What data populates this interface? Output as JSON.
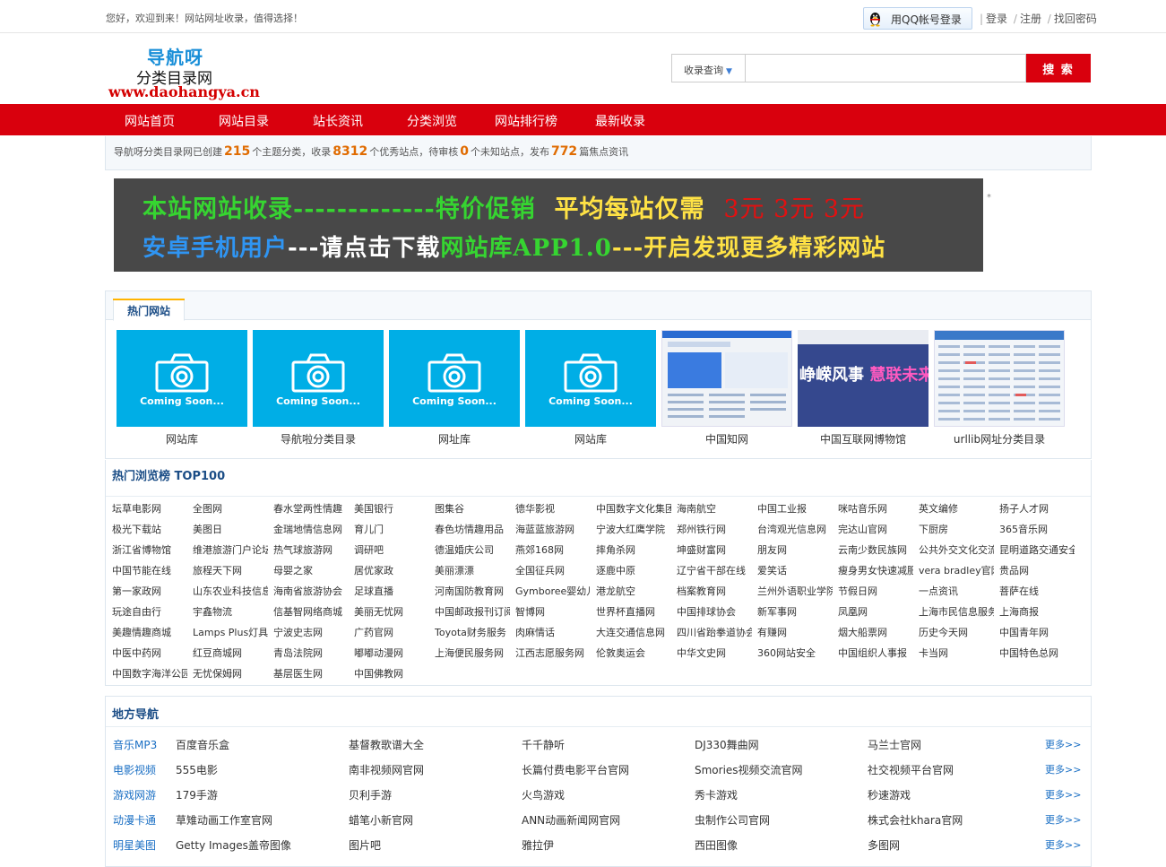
{
  "topbar": {
    "welcome": "您好，欢迎到来！网站网址收录，值得选择！",
    "qq_login": "用QQ帐号登录",
    "links": [
      "登录",
      "注册",
      "找回密码"
    ]
  },
  "logo": {
    "line1": "导航呀",
    "line2": "分类目录网",
    "line3": "www.daohangya.cn"
  },
  "search": {
    "scope": "收录查询",
    "value": "",
    "button": "搜 索"
  },
  "nav": [
    "网站首页",
    "网站目录",
    "站长资讯",
    "分类浏览",
    "网站排行榜",
    "最新收录"
  ],
  "stats": {
    "prefix": "导航呀分类目录网已创建",
    "categories": "215",
    "t1": "个主题分类，收录",
    "sites": "8312",
    "t2": "个优秀站点，待审核",
    "pending": "0",
    "t3": "个未知站点，发布",
    "articles": "772",
    "t4": "篇焦点资讯"
  },
  "banner": {
    "r1a": "本站网站收录-------------",
    "r1b": "特价促销",
    "r1c": "平均每站仅需",
    "r1d": "3元 3元 3元",
    "r2a": "安卓手机用户",
    "r2b": "---请点击下载",
    "r2c": "网站库APP1.0",
    "r2d": "---开启发现更多精彩网站",
    "mark": "*"
  },
  "hot": {
    "tab": "热门网站",
    "coming_soon": "Coming Soon...",
    "shot2_text_a": "峥嵘风事",
    "shot2_text_b": "慧联未来",
    "sites": [
      "网站库",
      "导航啦分类目录",
      "网址库",
      "网站库",
      "中国知网",
      "中国互联网博物馆",
      "urllib网址分类目录"
    ]
  },
  "top100": {
    "title": "热门浏览榜 TOP100",
    "rows": [
      [
        "坛草电影网",
        "全图网",
        "春水堂两性情趣",
        "美国银行",
        "图集谷",
        "德华影视",
        "中国数字文化集团",
        "海南航空",
        "中国工业报",
        "咪咕音乐网",
        "英文编修",
        "扬子人才网"
      ],
      [
        "极光下载站",
        "美图日",
        "金瑞地情信息网",
        "育儿门",
        "春色坊情趣用品",
        "海蓝蓝旅游网",
        "宁波大红鹰学院",
        "郑州铁行网",
        "台湾观光信息网",
        "完达山官网",
        "下厨房",
        "365音乐网"
      ],
      [
        "浙江省博物馆",
        "维港旅游门户论坛",
        "热气球旅游网",
        "调研吧",
        "德温婚庆公司",
        "燕郊168网",
        "摔角杀网",
        "坤盛财富网",
        "朋友网",
        "云南少数民族网",
        "公共外交文化交流",
        "昆明道路交通安全"
      ],
      [
        "中国节能在线",
        "旅程天下网",
        "母婴之家",
        "居优家政",
        "美丽漂漂",
        "全国征兵网",
        "逐鹿中原",
        "辽宁省干部在线",
        "爱笑话",
        "瘦身男女快速减肥",
        "vera bradley官网",
        "贵品网"
      ],
      [
        "第一家政网",
        "山东农业科技信息网",
        "海南省旅游协会",
        "足球直播",
        "河南国防教育网",
        "Gymboree婴幼儿",
        "港龙航空",
        "档案教育网",
        "兰州外语职业学院",
        "节假日网",
        "一点资讯",
        "菩萨在线"
      ],
      [
        "玩途自由行",
        "宇鑫物流",
        "信基智网络商城",
        "美丽无忧网",
        "中国邮政报刊订阅",
        "智博网",
        "世界杯直播网",
        "中国排球协会",
        "新军事网",
        "凤凰网",
        "上海市民信息服务",
        "上海商报"
      ],
      [
        "美趣情趣商城",
        "Lamps Plus灯具",
        "宁波史志网",
        "广药官网",
        "Toyota财务服务",
        "肉麻情话",
        "大连交通信息网",
        "四川省跆拳道协会",
        "有赚网",
        "烟大船票网",
        "历史今天网",
        "中国青年网"
      ],
      [
        "中医中药网",
        "红豆商城网",
        "青岛法院网",
        "嘟嘟动漫网",
        "上海便民服务网",
        "江西志愿服务网",
        "伦敦奥运会",
        "中华文史网",
        "360网站安全",
        "中国组织人事报",
        "卡当网",
        "中国特色总网"
      ],
      [
        "中国数字海洋公园",
        "无忧保姆网",
        "基层医生网",
        "中国佛教网"
      ]
    ]
  },
  "local": {
    "title": "地方导航",
    "more": "更多>>",
    "rows": [
      {
        "cat": "音乐MP3",
        "items": [
          "百度音乐盒",
          "基督教歌谱大全",
          "千千静听",
          "DJ330舞曲网",
          "马兰士官网"
        ]
      },
      {
        "cat": "电影视频",
        "items": [
          "555电影",
          "南非视频网官网",
          "长篇付费电影平台官网",
          "Smories视频交流官网",
          "社交视频平台官网"
        ]
      },
      {
        "cat": "游戏网游",
        "items": [
          "179手游",
          "贝利手游",
          "火鸟游戏",
          "秀卡游戏",
          "秒速游戏"
        ]
      },
      {
        "cat": "动漫卡通",
        "items": [
          "草雉动画工作室官网",
          "蜡笔小新官网",
          "ANN动画新闻网官网",
          "虫制作公司官网",
          "株式会社khara官网"
        ]
      },
      {
        "cat": "明星美图",
        "items": [
          "Getty Images盖帝图像",
          "图片吧",
          "雅拉伊",
          "西田图像",
          "多图网"
        ]
      }
    ]
  },
  "colors": {
    "nav_red": "#d9000d",
    "accent_blue": "#1b4d86",
    "stat_orange": "#e06b00",
    "coming_soon_bg": "#00aee6"
  }
}
